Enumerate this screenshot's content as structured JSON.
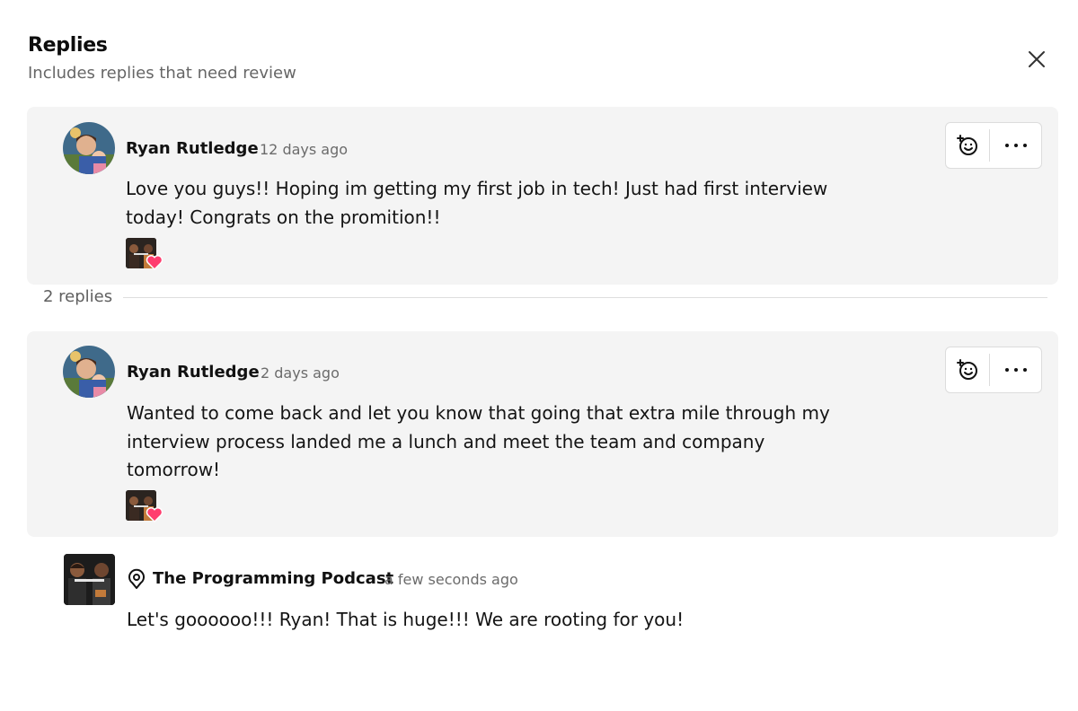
{
  "header": {
    "title": "Replies",
    "subtitle": "Includes replies that need review",
    "close_icon": "close-icon"
  },
  "parent_comment": {
    "author": "Ryan Rutledge",
    "time": "12 days ago",
    "text": "Love you guys!! Hoping im getting my first job in tech! Just had first interview today! Congrats on the promition!!",
    "reaction": "creator-heart",
    "actions": {
      "emoji_icon": "add-reaction-icon",
      "more_icon": "more-options-icon"
    }
  },
  "replies_count": "2 replies",
  "replies": [
    {
      "author": "Ryan Rutledge",
      "time": "2 days ago",
      "text": "Wanted to come back and let you know that going that extra mile through my interview process landed me a lunch and meet the team and company tomorrow!",
      "reaction": "creator-heart",
      "actions": {
        "emoji_icon": "add-reaction-icon",
        "more_icon": "more-options-icon"
      }
    },
    {
      "author": "The Programming Podcast",
      "time": "a few seconds ago",
      "text": "Let's goooooo!!! Ryan! That is huge!!! We are rooting for you!",
      "badge_icon": "creator-pin-icon"
    }
  ],
  "colors": {
    "card_bg": "#f4f4f4",
    "heart": "#ff3d6e",
    "muted_text": "#6b6b6b"
  }
}
